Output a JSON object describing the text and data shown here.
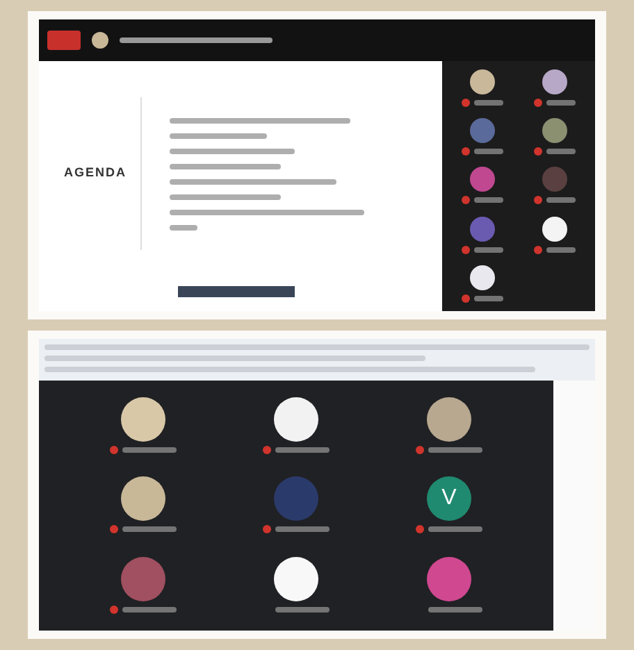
{
  "presentation": {
    "slide_title": "AGENDA",
    "recording": true
  },
  "side_tiles": [
    {
      "color": "#c9b89a",
      "muted": true
    },
    {
      "color": "#b8a8c8",
      "muted": true
    },
    {
      "color": "#5a6a9a",
      "muted": true
    },
    {
      "color": "#8a9070",
      "muted": true
    },
    {
      "color": "#c04890",
      "muted": true
    },
    {
      "color": "#5a4040",
      "muted": true
    },
    {
      "color": "#6a5ab0",
      "muted": true
    },
    {
      "color": "#f4f4f4",
      "muted": true
    },
    {
      "color": "#e8e8ee",
      "muted": true
    }
  ],
  "grid_tiles": [
    {
      "color": "#d8c8a8",
      "muted": true
    },
    {
      "color": "#f2f2f2",
      "muted": true
    },
    {
      "color": "#b8a890",
      "muted": true
    },
    {
      "color": "#c8b898",
      "muted": true
    },
    {
      "color": "#2a3a6a",
      "muted": true
    },
    {
      "color": "#1f8a70",
      "muted": true,
      "initial": "V"
    },
    {
      "color": "#a05060",
      "muted": true
    },
    {
      "color": "#f8f8f8",
      "muted": false
    },
    {
      "color": "#d04890",
      "muted": false
    }
  ]
}
